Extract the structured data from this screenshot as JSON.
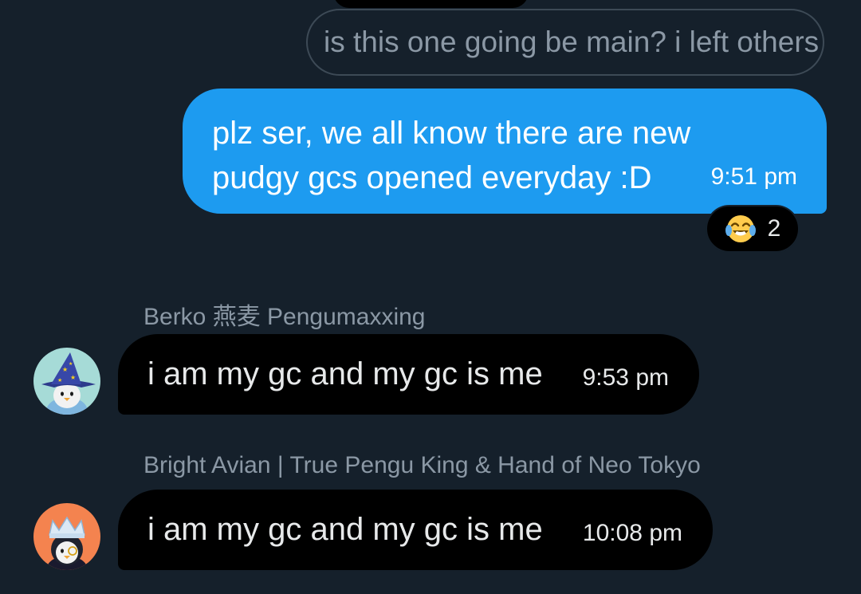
{
  "conversation": {
    "quoted": {
      "text": "is this one going be main? i left others"
    },
    "sent": {
      "line1": "plz ser, we all know there are new",
      "line2": "pudgy gcs opened everyday :D",
      "time": "9:51 pm",
      "reaction": {
        "emoji": "face-with-tears-of-joy",
        "count": "2"
      }
    },
    "received": [
      {
        "sender": "Berko 燕麦 Pengumaxxing",
        "text": "i am my gc and my gc is me",
        "time": "9:53 pm",
        "avatar": "wizard-penguin-avatar"
      },
      {
        "sender": "Bright Avian | True Pengu King & Hand of Neo Tokyo",
        "text": "i am my gc and my gc is me",
        "time": "10:08 pm",
        "avatar": "crowned-penguin-avatar"
      }
    ]
  },
  "colors": {
    "background": "#15202b",
    "sent_bubble": "#1d9bf0",
    "received_bubble": "#000000",
    "muted_text": "#8b98a5",
    "avatar1_bg": "#a6dbd7",
    "avatar2_bg": "#f4834f"
  }
}
